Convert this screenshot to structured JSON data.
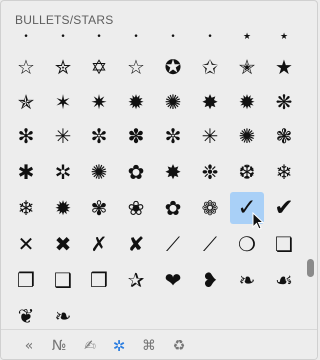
{
  "header": {
    "title": "BULLETS/STARS"
  },
  "symbols": [
    [
      "•",
      "•",
      "•",
      "•",
      "•",
      "•",
      "★",
      "★"
    ],
    [
      "☆",
      "✮",
      "✡",
      "☆",
      "✪",
      "✩",
      "✭",
      "★"
    ],
    [
      "✯",
      "✶",
      "✷",
      "✹",
      "✺",
      "✸",
      "✹",
      "❋"
    ],
    [
      "✻",
      "✳",
      "✼",
      "✽",
      "✼",
      "✳",
      "✺",
      "❃"
    ],
    [
      "✱",
      "✲",
      "✺",
      "✿",
      "✸",
      "❉",
      "❆",
      "❄"
    ],
    [
      "❄",
      "✹",
      "✾",
      "❀",
      "✿",
      "❁",
      "✓",
      "✔"
    ],
    [
      "✕",
      "✖",
      "✗",
      "✘",
      "⟋",
      "⟋",
      "❍",
      "❏"
    ],
    [
      "❐",
      "❑",
      "❒",
      "✰",
      "❤",
      "❥",
      "❧",
      "☙"
    ],
    [
      "❦",
      "❧"
    ]
  ],
  "selected": {
    "row": 5,
    "col": 6
  },
  "colors": {
    "selected_bg": "#a9d0f7",
    "active_tab": "#2b7de0"
  },
  "tabs": [
    {
      "icon": "left-double-angle-icon",
      "glyph": "«",
      "active": false
    },
    {
      "icon": "numero-sign-icon",
      "glyph": "№",
      "active": false
    },
    {
      "icon": "pencil-icon",
      "glyph": "✍",
      "active": false
    },
    {
      "icon": "asterisk-icon",
      "glyph": "✲",
      "active": true
    },
    {
      "icon": "command-key-icon",
      "glyph": "⌘",
      "active": false
    },
    {
      "icon": "recycle-icon",
      "glyph": "♻",
      "active": false
    }
  ]
}
